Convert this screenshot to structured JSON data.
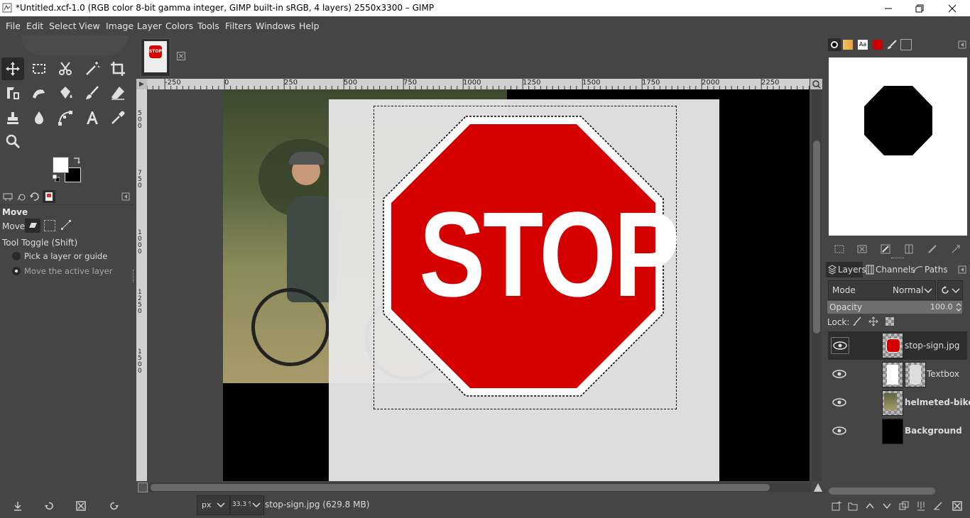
{
  "window": {
    "title": "*Untitled.xcf-1.0 (RGB color 8-bit gamma integer, GIMP built-in sRGB, 4 layers) 2550x3300 – GIMP",
    "icons": [
      "gimp-app-icon",
      "minimize-icon",
      "restore-icon",
      "close-icon"
    ]
  },
  "menu": [
    "File",
    "Edit",
    "Select",
    "View",
    "Image",
    "Layer",
    "Colors",
    "Tools",
    "Filters",
    "Windows",
    "Help"
  ],
  "toolbox": {
    "tools": [
      "move-tool",
      "rect-select-tool",
      "scissors-select-tool",
      "fuzzy-select-tool",
      "crop-tool",
      "unified-transform-tool",
      "warp-transform-tool",
      "bucket-fill-tool",
      "paintbrush-tool",
      "eraser-tool",
      "clone-tool",
      "smudge-tool",
      "paths-tool",
      "text-tool",
      "color-picker-tool",
      "zoom-tool"
    ],
    "active_tool": "move-tool",
    "fg_color": "#ffffff",
    "bg_color": "#000000"
  },
  "tool_options": {
    "title": "Move",
    "move_label": "Move:",
    "toggle_label": "Tool Toggle  (Shift)",
    "options": [
      "Pick a layer or guide",
      "Move the active layer"
    ],
    "selected_option": "Move the active layer"
  },
  "image_tab": {
    "thumb_text": "STOP"
  },
  "rulers": {
    "top": [
      "-250",
      "0",
      "250",
      "500",
      "750",
      "1000",
      "1250",
      "1500",
      "1750",
      "2000",
      "2250"
    ],
    "left": [
      "5 0 0",
      "7 5 0",
      "1 0 0 0",
      "1 2 5 0",
      "1 5 0 0"
    ]
  },
  "canvas": {
    "sign_text": "STOP",
    "sign_color": "#d40000"
  },
  "statusbar": {
    "unit": "px",
    "zoom": "33.3 %",
    "message": "stop-sign.jpg (629.8 MB)"
  },
  "dock": {
    "brush_tabs": [
      "brush-icon",
      "gradient-icon",
      "font-icon",
      "pattern-icon",
      "paint-dynamics-icon",
      "images-icon"
    ],
    "tabs": [
      "Layers",
      "Channels",
      "Paths"
    ],
    "mode_label": "Mode",
    "mode_value": "Normal",
    "opacity_label": "Opacity",
    "opacity_value": "100.0",
    "lock_label": "Lock:",
    "layers": [
      {
        "name": "stop-sign.jpg",
        "bold": false,
        "active": true
      },
      {
        "name": "Textbox",
        "bold": false,
        "active": false
      },
      {
        "name": "helmeted-biker",
        "bold": true,
        "active": false
      },
      {
        "name": "Background",
        "bold": true,
        "active": false
      }
    ]
  }
}
